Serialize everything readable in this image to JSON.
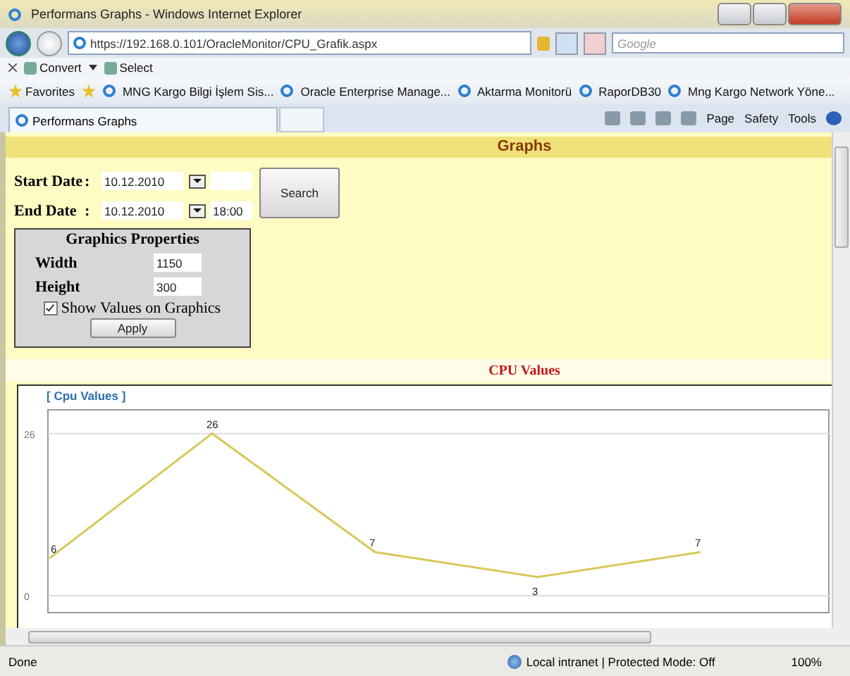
{
  "window": {
    "title": "Performans Graphs - Windows Internet Explorer"
  },
  "address_bar": {
    "url": "https://192.168.0.101/OracleMonitor/CPU_Grafik.aspx",
    "search_placeholder": "Google"
  },
  "toolbar": {
    "items": [
      "Convert",
      "Select"
    ]
  },
  "favorites": {
    "label": "Favorites",
    "links": [
      "MNG Kargo Bilgi İşlem Sis...",
      "Oracle Enterprise Manage...",
      "Aktarma Monitorü",
      "RaporDB30",
      "Mng Kargo Network Yöne..."
    ]
  },
  "tab": {
    "label": "Performans Graphs"
  },
  "command_bar": [
    "Page",
    "Safety",
    "Tools"
  ],
  "page": {
    "header": "Graphs",
    "start_date": {
      "label": "Start Date",
      "separator": ":",
      "date": "10.12.2010"
    },
    "end_date": {
      "label": "End Date",
      "separator": ":",
      "date": "10.12.2010",
      "time": "18:00"
    },
    "search_button": "Search",
    "graphics_properties": {
      "title": "Graphics Properties",
      "width": {
        "label": "Width",
        "value": "1150"
      },
      "height": {
        "label": "Height",
        "value": "300"
      },
      "show_values": {
        "label": "Show Values on Graphics",
        "checked": true
      },
      "apply_button": "Apply"
    },
    "chart_heading": "CPU Values",
    "chart_data": {
      "type": "line",
      "title": "[ Cpu Values ]",
      "ylim": [
        -2.7,
        29.8
      ],
      "yticks": [
        0,
        26
      ],
      "data_labels": true,
      "series": [
        {
          "color": "#d8c85a",
          "values": [
            6,
            26,
            7,
            3,
            7
          ]
        }
      ]
    }
  },
  "status_bar": {
    "text": "Done",
    "zone": "Local intranet | Protected Mode: Off",
    "zoom": "100%"
  }
}
